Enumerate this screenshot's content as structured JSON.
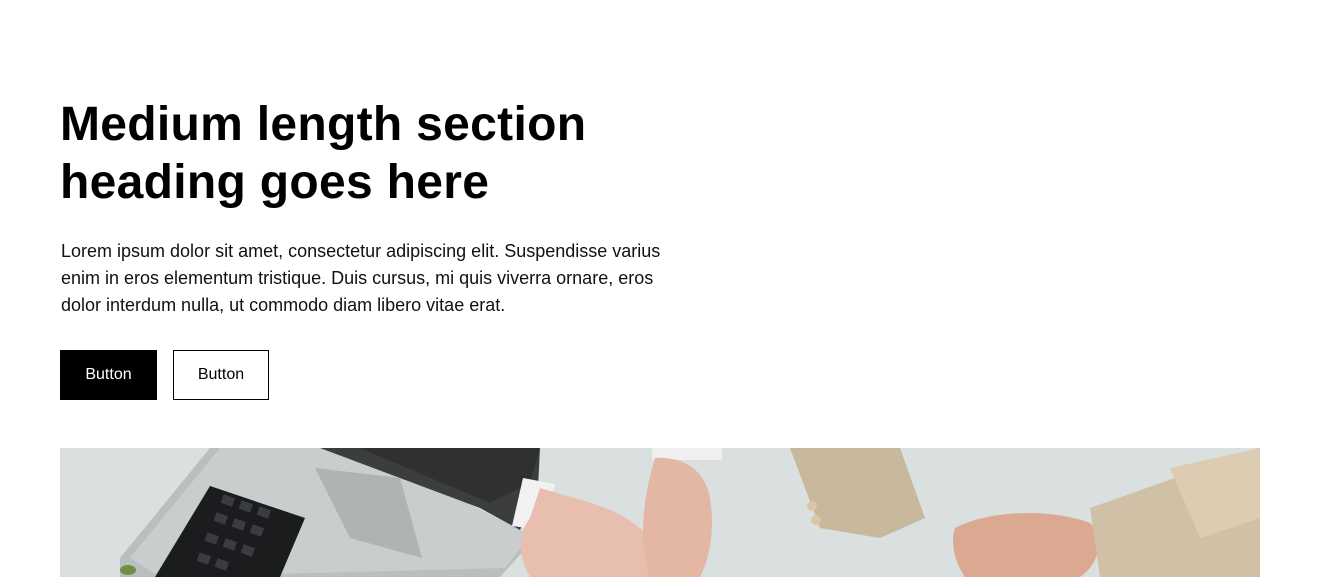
{
  "hero": {
    "heading_line1": "Medium length section",
    "heading_line2": "heading goes here",
    "body": "Lorem ipsum dolor sit amet, consectetur adipiscing elit. Suspendisse varius enim in eros elementum tristique. Duis cursus, mi quis viverra ornare, eros dolor interdum nulla, ut commodo diam libero vitae erat.",
    "primary_button_label": "Button",
    "secondary_button_label": "Button"
  },
  "colors": {
    "background": "#ffffff",
    "text": "#000000",
    "primary_button_bg": "#000000",
    "primary_button_text": "#ffffff"
  }
}
